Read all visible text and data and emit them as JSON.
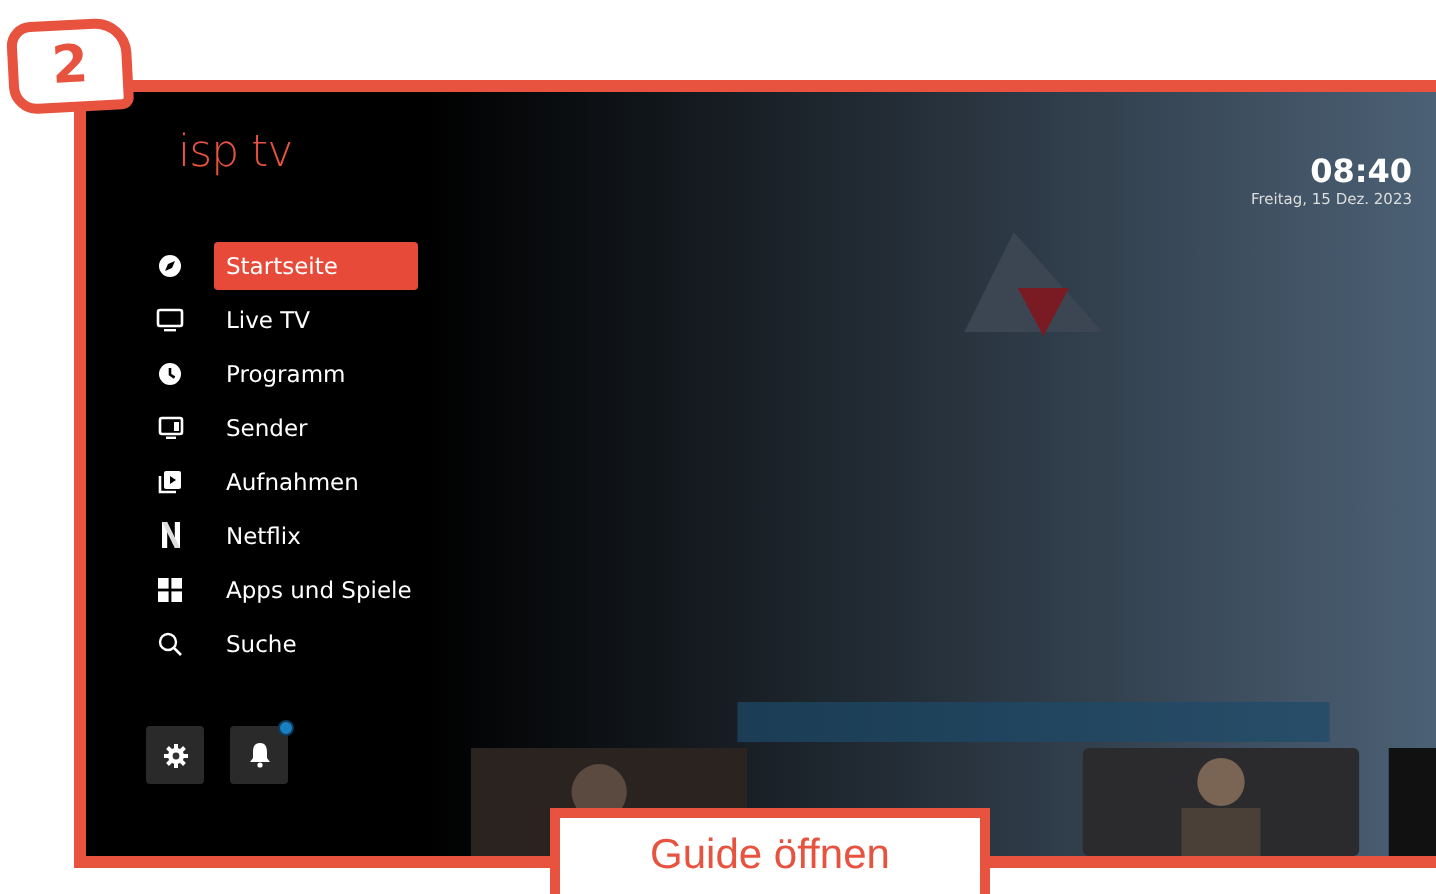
{
  "step_badge": "2",
  "logo": "isp tv",
  "clock": {
    "time": "08:40",
    "date": "Freitag, 15 Dez. 2023"
  },
  "menu": [
    {
      "label": "Startseite",
      "kind": "compass",
      "selected": true
    },
    {
      "label": "Live TV",
      "kind": "tv",
      "selected": false
    },
    {
      "label": "Programm",
      "kind": "clock",
      "selected": false
    },
    {
      "label": "Sender",
      "kind": "channels",
      "selected": false
    },
    {
      "label": "Aufnahmen",
      "kind": "recordings",
      "selected": false
    },
    {
      "label": "Netflix",
      "kind": "n",
      "selected": false
    },
    {
      "label": "Apps und Spiele",
      "kind": "grid",
      "selected": false
    },
    {
      "label": "Suche",
      "kind": "search",
      "selected": false
    }
  ],
  "bottom_buttons": [
    {
      "kind": "settings",
      "notification": false
    },
    {
      "kind": "bell",
      "notification": true
    }
  ],
  "callout": "Guide öffnen"
}
